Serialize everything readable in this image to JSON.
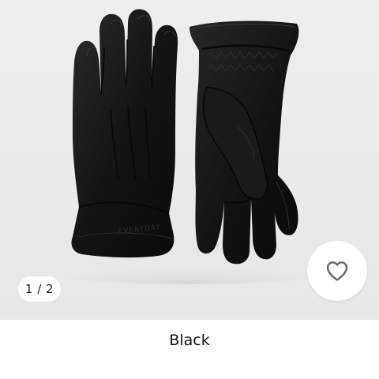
{
  "product": {
    "image_alt": "Black leather gloves",
    "pager": {
      "text": "1 / 2",
      "current": 1,
      "total": 2
    },
    "brand_emboss": "EVERYDAY",
    "favorite": {
      "icon": "heart-outline-icon",
      "active": false
    },
    "color_name": "Black"
  },
  "colors": {
    "glove": "#151515",
    "background": "#ebebec",
    "surface": "#ffffff",
    "text": "#111111"
  }
}
